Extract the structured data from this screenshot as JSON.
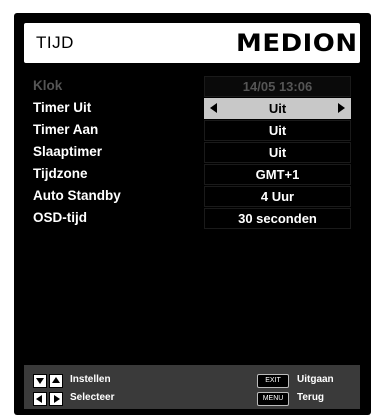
{
  "header": {
    "title": "TIJD",
    "brand": "MEDION"
  },
  "settings": [
    {
      "label": "Klok",
      "value": "14/05   13:06",
      "state": "disabled"
    },
    {
      "label": "Timer Uit",
      "value": "Uit",
      "state": "selected"
    },
    {
      "label": "Timer Aan",
      "value": "Uit",
      "state": "normal"
    },
    {
      "label": "Slaaptimer",
      "value": "Uit",
      "state": "normal"
    },
    {
      "label": "Tijdzone",
      "value": "GMT+1",
      "state": "normal"
    },
    {
      "label": "Auto Standby",
      "value": "4 Uur",
      "state": "normal"
    },
    {
      "label": "OSD-tijd",
      "value": "30 seconden",
      "state": "normal"
    }
  ],
  "footer": {
    "adjust_label": "Instellen",
    "select_label": "Selecteer",
    "exit_key": "EXIT",
    "exit_label": "Uitgaan",
    "menu_key": "MENU",
    "back_label": "Terug"
  },
  "colors": {
    "background": "#000000",
    "header": "#ffffff",
    "selected_value": "#c8c8c8",
    "disabled_text": "#555555",
    "footer_bar": "#3a3a3a"
  }
}
